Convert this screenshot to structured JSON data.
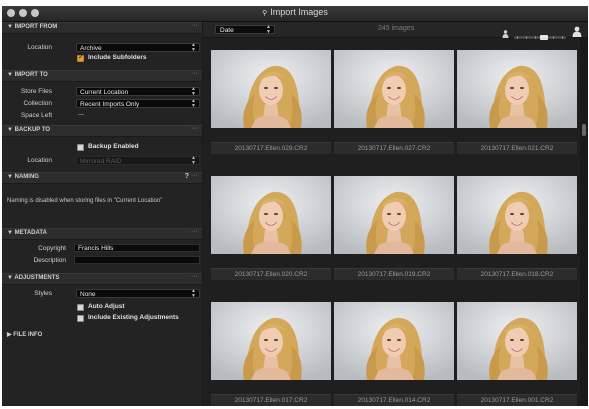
{
  "window": {
    "title": "Import Images"
  },
  "sidebar": {
    "import_from": {
      "header": "IMPORT FROM",
      "location_label": "Location",
      "location_value": "Archive",
      "include_subfolders_label": "Include Subfolders",
      "include_subfolders_checked": true
    },
    "import_to": {
      "header": "IMPORT TO",
      "store_files_label": "Store Files",
      "store_files_value": "Current Location",
      "collection_label": "Collection",
      "collection_value": "Recent Imports Only",
      "space_left_label": "Space Left",
      "space_left_value": "---"
    },
    "backup_to": {
      "header": "BACKUP TO",
      "backup_enabled_label": "Backup Enabled",
      "backup_enabled_checked": false,
      "location_label": "Location",
      "location_value": "Mirrored RAID"
    },
    "naming": {
      "header": "NAMING",
      "help": "?",
      "note": "Naming is disabled when storing files in \"Current Location\""
    },
    "metadata": {
      "header": "METADATA",
      "copyright_label": "Copyright",
      "copyright_value": "Francis Hills",
      "description_label": "Description",
      "description_value": ""
    },
    "adjustments": {
      "header": "ADJUSTMENTS",
      "styles_label": "Styles",
      "styles_value": "None",
      "auto_adjust_label": "Auto Adjust",
      "auto_adjust_checked": false,
      "include_existing_label": "Include Existing Adjustments",
      "include_existing_checked": false
    },
    "file_info": {
      "header": "FILE INFO"
    }
  },
  "toolbar": {
    "sort_value": "Date",
    "image_count": "245 images"
  },
  "thumbnails": [
    {
      "filename": "20130717.Ellen.029.CR2"
    },
    {
      "filename": "20130717.Ellen.027.CR2"
    },
    {
      "filename": "20130717.Ellen.021.CR2"
    },
    {
      "filename": "20130717.Ellen.020.CR2"
    },
    {
      "filename": "20130717.Ellen.019.CR2"
    },
    {
      "filename": "20130717.Ellen.018.CR2"
    },
    {
      "filename": "20130717.Ellen.017.CR2"
    },
    {
      "filename": "20130717.Ellen.014.CR2"
    },
    {
      "filename": "20130717.Ellen.001.CR2"
    }
  ],
  "colors": {
    "accent": "#e0a040",
    "panel": "#232323",
    "background": "#1a1a1a"
  },
  "icons": [
    "close-icon",
    "minimize-icon",
    "zoom-icon",
    "camera-icon",
    "person-small-icon",
    "person-large-icon",
    "chevron-up-down-icon",
    "disclosure-triangle-icon"
  ]
}
